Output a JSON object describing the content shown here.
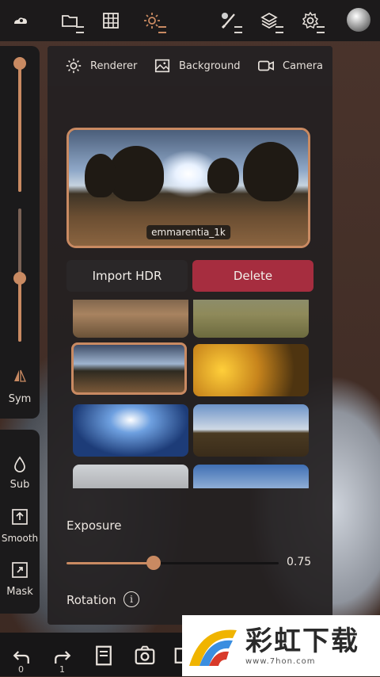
{
  "topbar": {
    "icons": [
      "cloud-icon",
      "folder-icon",
      "grid-icon",
      "sun-icon",
      "brush-icon",
      "layers-icon",
      "settings-icon",
      "matcap-sphere"
    ],
    "accent_color": "#c98a62"
  },
  "left_panel": {
    "sym_label": "Sym",
    "sub_label": "Sub",
    "smooth_label": "Smooth",
    "mask_label": "Mask"
  },
  "tabs": [
    {
      "label": "Renderer",
      "icon": "sun-icon"
    },
    {
      "label": "Background",
      "icon": "image-icon"
    },
    {
      "label": "Camera",
      "icon": "camera-icon"
    }
  ],
  "hdr": {
    "selected_name": "emmarentia_1k",
    "import_label": "Import HDR",
    "delete_label": "Delete",
    "delete_color": "#a62d3f",
    "thumbnails_visible": 8,
    "selected_index": 2
  },
  "exposure": {
    "label": "Exposure",
    "value": "0.75",
    "fraction": 0.41
  },
  "rotation": {
    "label": "Rotation",
    "info_glyph": "i"
  },
  "bottombar": {
    "undo_count": "0",
    "redo_count": "1"
  },
  "watermark": {
    "title": "彩虹下载",
    "url": "www.7hon.com"
  }
}
